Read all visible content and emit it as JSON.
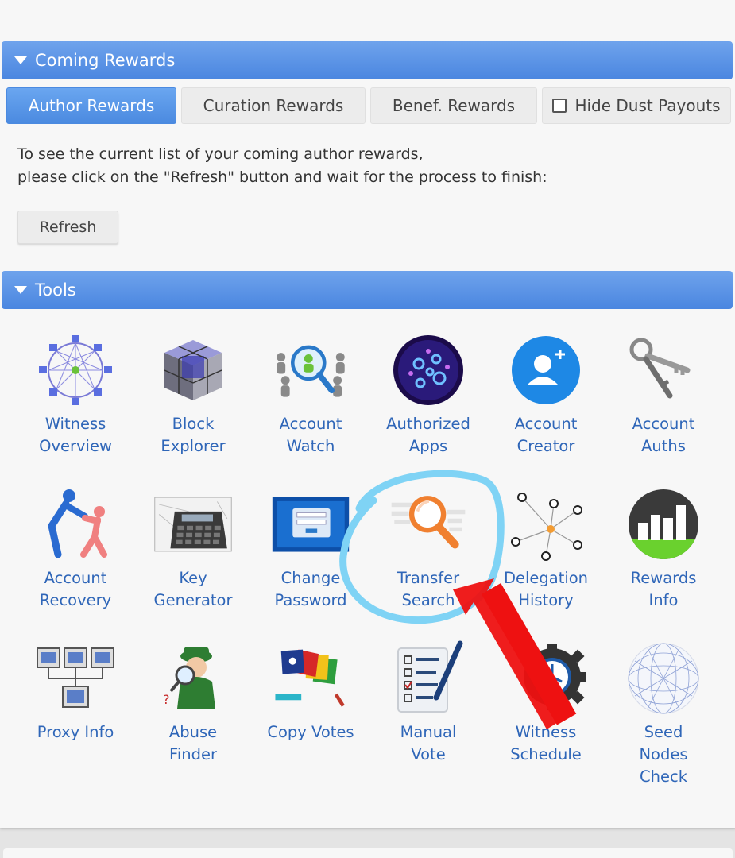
{
  "coming_rewards": {
    "header": "Coming Rewards",
    "tabs": [
      {
        "label": "Author Rewards",
        "active": true
      },
      {
        "label": "Curation Rewards",
        "active": false
      },
      {
        "label": "Benef. Rewards",
        "active": false
      }
    ],
    "hide_dust_label": "Hide Dust Payouts",
    "hide_dust_checked": false,
    "description_line1": "To see the current list of your coming author rewards,",
    "description_line2": "please click on the \"Refresh\" button and wait for the process to finish:",
    "refresh_label": "Refresh"
  },
  "tools": {
    "header": "Tools",
    "items": [
      {
        "label": "Witness\nOverview",
        "icon": "witness-network-icon"
      },
      {
        "label": "Block\nExplorer",
        "icon": "cube-blocks-icon"
      },
      {
        "label": "Account\nWatch",
        "icon": "magnifier-people-icon"
      },
      {
        "label": "Authorized\nApps",
        "icon": "sphere-apps-icon"
      },
      {
        "label": "Account\nCreator",
        "icon": "add-user-icon"
      },
      {
        "label": "Account\nAuths",
        "icon": "keys-icon"
      },
      {
        "label": "Account\nRecovery",
        "icon": "helping-figures-icon"
      },
      {
        "label": "Key\nGenerator",
        "icon": "calculator-icon"
      },
      {
        "label": "Change\nPassword",
        "icon": "login-screen-icon"
      },
      {
        "label": "Transfer\nSearch",
        "icon": "magnifying-glass-icon"
      },
      {
        "label": "Delegation\nHistory",
        "icon": "delegation-network-icon"
      },
      {
        "label": "Rewards\nInfo",
        "icon": "bar-chart-icon"
      },
      {
        "label": "Proxy Info",
        "icon": "monitors-network-icon"
      },
      {
        "label": "Abuse\nFinder",
        "icon": "detective-icon"
      },
      {
        "label": "Copy Votes",
        "icon": "flags-icon"
      },
      {
        "label": "Manual\nVote",
        "icon": "checklist-pen-icon"
      },
      {
        "label": "Witness\nSchedule",
        "icon": "gear-clock-icon"
      },
      {
        "label": "Seed\nNodes\nCheck",
        "icon": "globe-mesh-icon"
      }
    ]
  },
  "colors": {
    "header_blue": "#4a86e0",
    "link_blue": "#2f66b8",
    "annotation_circle": "#7fd3f5",
    "annotation_arrow": "#ee1111"
  }
}
